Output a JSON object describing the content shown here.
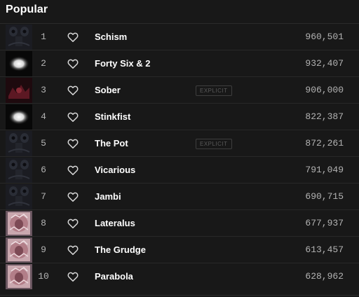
{
  "section": {
    "title": "Popular"
  },
  "tracks": [
    {
      "rank": "1",
      "title": "Schism",
      "plays": "960,501",
      "explicit": "",
      "art": "album-10000-days-art"
    },
    {
      "rank": "2",
      "title": "Forty Six & 2",
      "plays": "932,407",
      "explicit": "",
      "art": "album-aenima-art"
    },
    {
      "rank": "3",
      "title": "Sober",
      "plays": "906,000",
      "explicit": "EXPLICIT",
      "art": "album-undertow-art"
    },
    {
      "rank": "4",
      "title": "Stinkfist",
      "plays": "822,387",
      "explicit": "",
      "art": "album-aenima-art"
    },
    {
      "rank": "5",
      "title": "The Pot",
      "plays": "872,261",
      "explicit": "EXPLICIT",
      "art": "album-10000-days-art"
    },
    {
      "rank": "6",
      "title": "Vicarious",
      "plays": "791,049",
      "explicit": "",
      "art": "album-10000-days-art"
    },
    {
      "rank": "7",
      "title": "Jambi",
      "plays": "690,715",
      "explicit": "",
      "art": "album-10000-days-art"
    },
    {
      "rank": "8",
      "title": "Lateralus",
      "plays": "677,937",
      "explicit": "",
      "art": "album-lateralus-art"
    },
    {
      "rank": "9",
      "title": "The Grudge",
      "plays": "613,457",
      "explicit": "",
      "art": "album-lateralus-art"
    },
    {
      "rank": "10",
      "title": "Parabola",
      "plays": "628,962",
      "explicit": "",
      "art": "album-lateralus-art"
    }
  ],
  "colors": {
    "background": "#181818",
    "text_primary": "#ffffff",
    "text_secondary": "#b3b3b3",
    "badge_border": "#3e3e3e"
  },
  "icons": {
    "like": "heart-outline-icon"
  }
}
